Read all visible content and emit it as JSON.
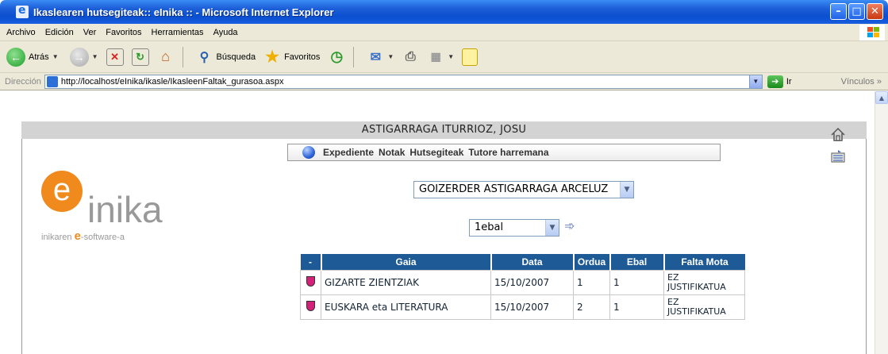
{
  "window": {
    "title": "Ikaslearen hutsegiteak:: eInika :: - Microsoft Internet Explorer"
  },
  "menu": {
    "items": [
      "Archivo",
      "Edición",
      "Ver",
      "Favoritos",
      "Herramientas",
      "Ayuda"
    ]
  },
  "toolbar": {
    "back_label": "Atrás",
    "search_label": "Búsqueda",
    "favorites_label": "Favoritos"
  },
  "address": {
    "label": "Dirección",
    "url": "http://localhost/eInika/ikasle/IkasleenFaltak_gurasoa.aspx",
    "go_label": "Ir",
    "links_label": "Vínculos"
  },
  "page": {
    "user_name": "ASTIGARRAGA ITURRIOZ, JOSU",
    "nav": [
      "Expediente",
      "Notak",
      "Hutsegiteak",
      "Tutore harremana"
    ],
    "logo": {
      "letter": "e",
      "word": "inika",
      "tag_prefix": "inikaren ",
      "tag_e": "e",
      "tag_suffix": "-software-a"
    },
    "student_select": "GOIZERDER ASTIGARRAGA ARCELUZ",
    "eval_select": "1ebal",
    "table": {
      "headers": [
        "-",
        "Gaia",
        "Data",
        "Ordua",
        "Ebal",
        "Falta Mota"
      ],
      "rows": [
        {
          "gaia": "GIZARTE ZIENTZIAK",
          "data": "15/10/2007",
          "ordua": "1",
          "ebal": "1",
          "falta_1": "EZ",
          "falta_2": "JUSTIFIKATUA"
        },
        {
          "gaia": "EUSKARA eta LITERATURA",
          "data": "15/10/2007",
          "ordua": "2",
          "ebal": "1",
          "falta_1": "EZ",
          "falta_2": "JUSTIFIKATUA"
        }
      ]
    }
  },
  "colors": {
    "title_bar": "#0a4fd0",
    "table_header": "#1e5b96",
    "logo_orange": "#f08a1c",
    "shield_pink": "#d6217b"
  }
}
